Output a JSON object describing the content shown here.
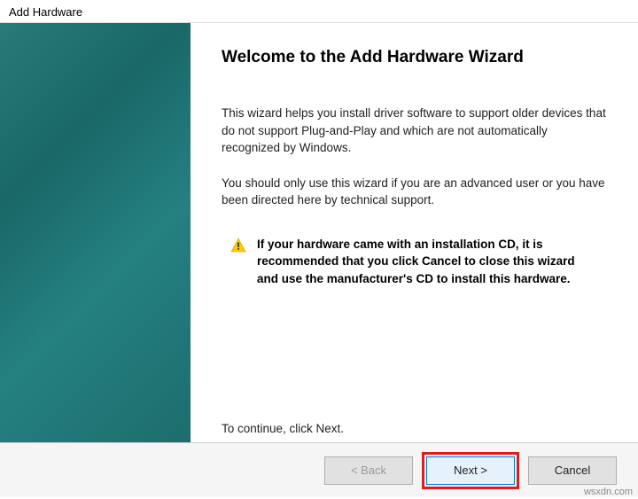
{
  "window": {
    "title": "Add Hardware"
  },
  "content": {
    "heading": "Welcome to the Add Hardware Wizard",
    "para1": "This wizard helps you install driver software to support older devices that do not support Plug-and-Play and which are not automatically recognized by Windows.",
    "para2": "You should only use this wizard if you are an advanced user or you have been directed here by technical support.",
    "note": "If your hardware came with an installation CD, it is recommended that you click Cancel to close this wizard and use the manufacturer's CD to install this hardware.",
    "continue": "To continue, click Next."
  },
  "buttons": {
    "back": "< Back",
    "next": "Next >",
    "cancel": "Cancel"
  },
  "watermark": "wsxdn.com"
}
